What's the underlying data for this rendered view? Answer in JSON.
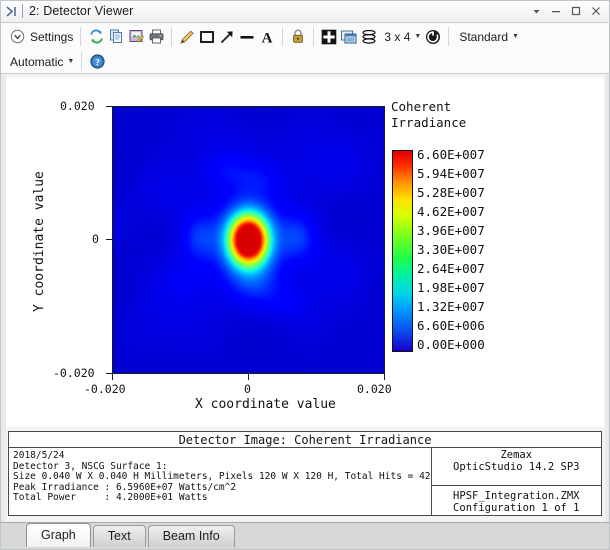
{
  "window": {
    "title": "2: Detector Viewer",
    "pin_icon": "pin-icon",
    "controls": [
      {
        "name": "dropdown-arrow-button",
        "glyph": "▼"
      },
      {
        "name": "minimize-button",
        "glyph": "–"
      },
      {
        "name": "maximize-button",
        "glyph": "□"
      },
      {
        "name": "close-button",
        "glyph": "✕"
      }
    ]
  },
  "toolbar": {
    "settings_label": "Settings",
    "grid_label": "3 x 4",
    "standard_label": "Standard",
    "automatic_label": "Automatic",
    "icons": [
      "settings-chevron-icon",
      "refresh-icon",
      "copy-icon",
      "save-image-icon",
      "print-icon",
      "pencil-icon",
      "rectangle-icon",
      "arrow-icon",
      "line-icon",
      "text-icon",
      "lock-icon",
      "fit-window-icon",
      "window-copy-icon",
      "layers-icon",
      "refresh-circle-icon",
      "help-icon"
    ]
  },
  "chart_data": {
    "type": "heatmap",
    "title": "Detector Image: Coherent Irradiance",
    "xlabel": "X coordinate value",
    "ylabel": "Y coordinate value",
    "xticks": [
      "-0.020",
      "0",
      "0.020"
    ],
    "yticks": [
      "0.020",
      "0",
      "-0.020"
    ],
    "xlim": [
      -0.02,
      0.02
    ],
    "ylim": [
      -0.02,
      0.02
    ],
    "grid": false,
    "colorbar": {
      "title_line1": "Coherent",
      "title_line2": "Irradiance",
      "position": "right",
      "labels": [
        "6.60E+007",
        "5.94E+007",
        "5.28E+007",
        "4.62E+007",
        "3.96E+007",
        "3.30E+007",
        "2.64E+007",
        "1.98E+007",
        "1.32E+007",
        "6.60E+006",
        "0.00E+000"
      ],
      "values": [
        66000000,
        59400000,
        52800000,
        46200000,
        39600000,
        33000000,
        26400000,
        19800000,
        13200000,
        6600000,
        0
      ],
      "vmin": 0,
      "vmax": 66000000,
      "colormap": "jet"
    },
    "peak": {
      "x": 0.0,
      "y": 0.0,
      "value": 65960000
    },
    "pixels": {
      "width": 120,
      "height": 120
    },
    "notes": "Central bright PSF lobe at origin with weaker side lobes left/right and diffuse low-level speckle"
  },
  "info": {
    "header": "Detector Image: Coherent Irradiance",
    "left_lines": [
      "2018/5/24",
      "Detector 3, NSCG Surface 1:",
      "Size 0.040 W X 0.040 H Millimeters, Pixels 120 W X 120 H, Total Hits = 42",
      "Peak Irradiance : 6.5960E+07 Watts/cm^2",
      "Total Power     : 4.2000E+01 Watts"
    ],
    "right_top": [
      "Zemax",
      "OpticStudio 14.2 SP3"
    ],
    "right_bottom": [
      "HPSF_Integration.ZMX",
      "Configuration 1 of 1"
    ]
  },
  "tabs": [
    {
      "label": "Graph",
      "active": true
    },
    {
      "label": "Text",
      "active": false
    },
    {
      "label": "Beam Info",
      "active": false
    }
  ],
  "colors": {
    "accent": "#1a4d8f",
    "plot_low": "#1400c8",
    "plot_high": "#e00000",
    "titlebar_bg": "#fdfdfd"
  }
}
